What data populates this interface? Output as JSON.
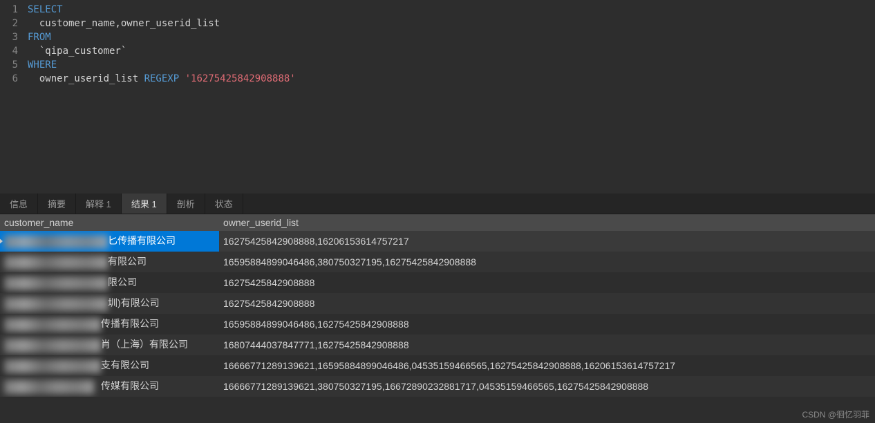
{
  "editor": {
    "lines": [
      {
        "num": "1",
        "tokens": [
          {
            "text": "SELECT",
            "cls": "keyword"
          }
        ]
      },
      {
        "num": "2",
        "tokens": [
          {
            "text": "  customer_name,owner_userid_list",
            "cls": "identifier"
          }
        ]
      },
      {
        "num": "3",
        "tokens": [
          {
            "text": "FROM",
            "cls": "keyword"
          }
        ]
      },
      {
        "num": "4",
        "tokens": [
          {
            "text": "  `qipa_customer`",
            "cls": "identifier"
          }
        ]
      },
      {
        "num": "5",
        "tokens": [
          {
            "text": "WHERE",
            "cls": "keyword"
          }
        ]
      },
      {
        "num": "6",
        "tokens": [
          {
            "text": "  owner_userid_list ",
            "cls": "identifier"
          },
          {
            "text": "REGEXP ",
            "cls": "keyword"
          },
          {
            "text": "'16275425842908888'",
            "cls": "string"
          }
        ]
      }
    ]
  },
  "tabs": {
    "items": [
      {
        "label": "信息",
        "active": false
      },
      {
        "label": "摘要",
        "active": false
      },
      {
        "label": "解释 1",
        "active": false
      },
      {
        "label": "结果 1",
        "active": true
      },
      {
        "label": "剖析",
        "active": false
      },
      {
        "label": "状态",
        "active": false
      }
    ]
  },
  "table": {
    "headers": [
      "customer_name",
      "owner_userid_list"
    ],
    "rows": [
      {
        "name_visible": "匕传播有限公司",
        "userid": "16275425842908888,16206153614757217",
        "selected": true,
        "blur_width": 150
      },
      {
        "name_visible": "有限公司",
        "userid": "16595884899046486,380750327195,16275425842908888",
        "selected": false,
        "blur_width": 150
      },
      {
        "name_visible": "限公司",
        "userid": "16275425842908888",
        "selected": false,
        "blur_width": 150
      },
      {
        "name_visible": "圳)有限公司",
        "userid": "16275425842908888",
        "selected": false,
        "blur_width": 150
      },
      {
        "name_visible": "传播有限公司",
        "userid": "16595884899046486,16275425842908888",
        "selected": false,
        "blur_width": 140
      },
      {
        "name_visible": "肖（上海）有限公司",
        "userid": "16807444037847771,16275425842908888",
        "selected": false,
        "blur_width": 140
      },
      {
        "name_visible": "支有限公司",
        "userid": "16666771289139621,16595884899046486,04535159466565,16275425842908888,16206153614757217",
        "selected": false,
        "blur_width": 140
      },
      {
        "name_visible": "传媒有限公司",
        "userid": "16666771289139621,380750327195,16672890232881717,04535159466565,16275425842908888",
        "selected": false,
        "blur_width": 130
      }
    ]
  },
  "watermark": "CSDN @徊忆羽菲"
}
